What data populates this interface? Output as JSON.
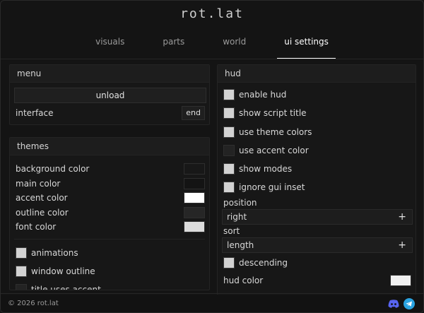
{
  "app": {
    "title": "rot.lat"
  },
  "tabs": [
    {
      "label": "visuals"
    },
    {
      "label": "parts"
    },
    {
      "label": "world"
    },
    {
      "label": "ui settings"
    }
  ],
  "menu": {
    "header": "menu",
    "unload_label": "unload",
    "interface_label": "interface",
    "interface_key": "end"
  },
  "themes": {
    "header": "themes",
    "colors": [
      {
        "label": "background color",
        "value": "#181818"
      },
      {
        "label": "main color",
        "value": "#141414"
      },
      {
        "label": "accent color",
        "value": "#ffffff"
      },
      {
        "label": "outline color",
        "value": "#262626"
      },
      {
        "label": "font color",
        "value": "#dcdcdc"
      }
    ],
    "toggles": [
      {
        "label": "animations",
        "checked": true
      },
      {
        "label": "window outline",
        "checked": true
      },
      {
        "label": "title uses accent",
        "checked": false
      }
    ]
  },
  "hud": {
    "header": "hud",
    "toggles": [
      {
        "label": "enable hud",
        "checked": true
      },
      {
        "label": "show script title",
        "checked": true
      },
      {
        "label": "use theme colors",
        "checked": true
      },
      {
        "label": "use accent color",
        "checked": false
      },
      {
        "label": "show modes",
        "checked": true
      },
      {
        "label": "ignore gui inset",
        "checked": true
      }
    ],
    "position_label": "position",
    "position_value": "right",
    "sort_label": "sort",
    "sort_value": "length",
    "descending_label": "descending",
    "descending_checked": true,
    "hud_color_label": "hud color",
    "hud_color_value": "#f0f0f0"
  },
  "footer": {
    "copyright": "© 2026 rot.lat"
  },
  "icons": {
    "discord": "discord-icon",
    "telegram": "telegram-icon"
  },
  "colors": {
    "accent": "#ffffff",
    "discord": "#5865f2",
    "telegram": "#2aa3e0"
  }
}
